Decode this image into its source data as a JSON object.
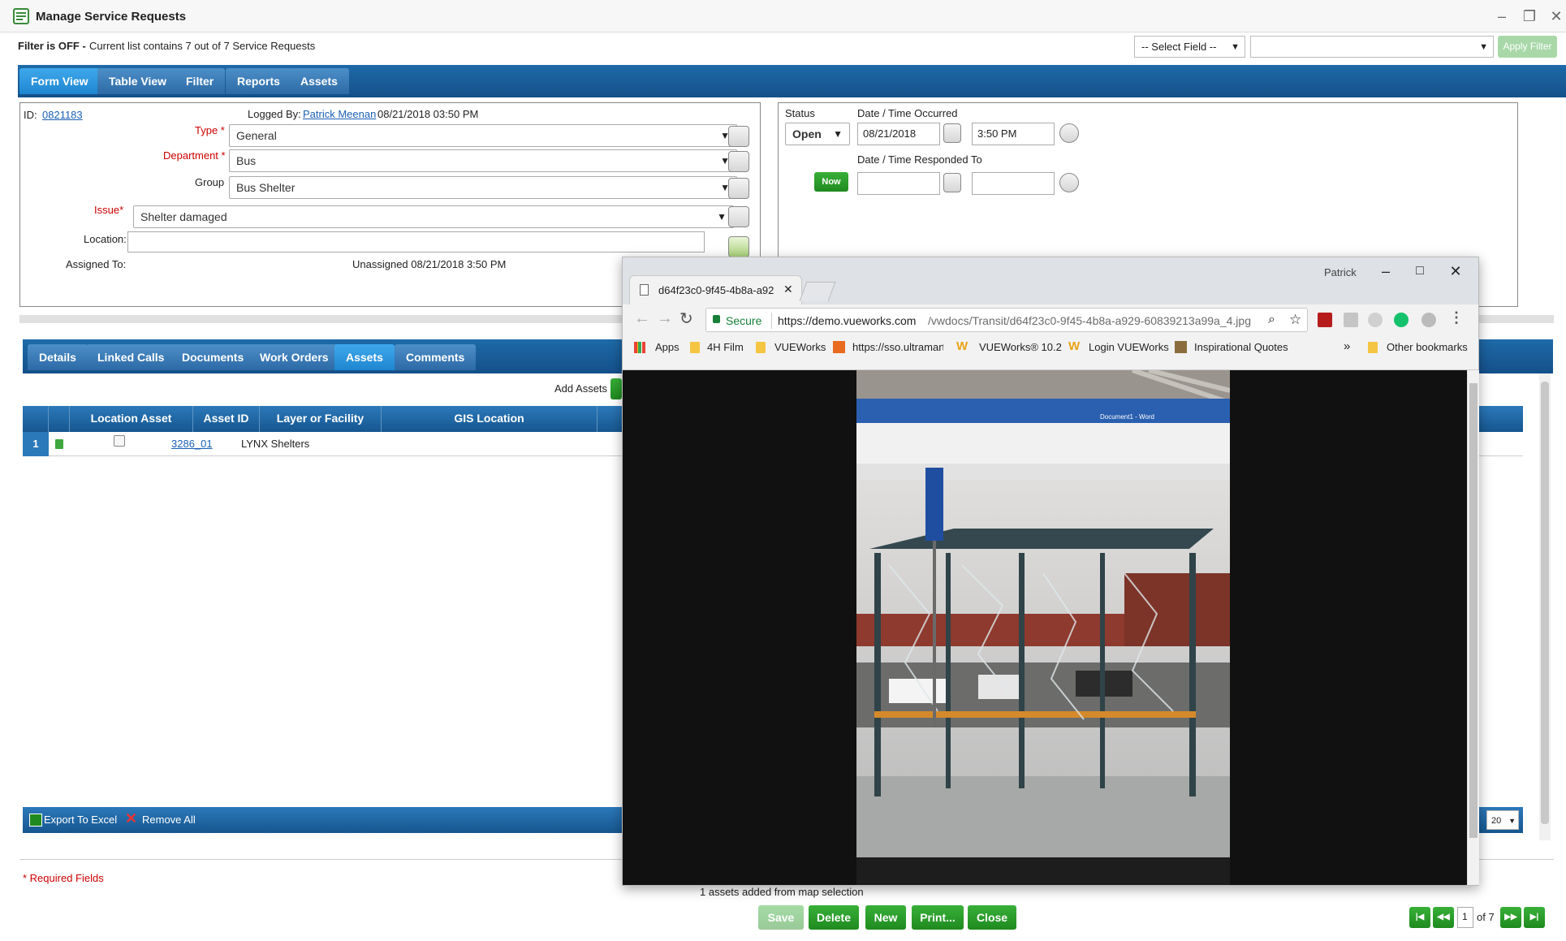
{
  "window": {
    "title": "Manage Service Requests",
    "controls": [
      "minimize-icon",
      "restore-icon",
      "close-icon"
    ]
  },
  "filter": {
    "status": "Filter is OFF -",
    "summary": "Current list contains 7 out of 7 Service Requests",
    "select_field": "-- Select Field --",
    "value_field": "",
    "apply_label": "Apply Filter"
  },
  "tabs": [
    {
      "label": "Form View",
      "active": true
    },
    {
      "label": "Table View",
      "active": false
    },
    {
      "label": "Filter",
      "active": false
    },
    {
      "label": "Reports",
      "active": false
    },
    {
      "label": "Assets",
      "active": false
    }
  ],
  "form": {
    "id_label": "ID:",
    "id_value": "0821183",
    "logged_by_label": "Logged By:",
    "logged_by_name": "Patrick Meenan",
    "logged_by_time": "08/21/2018 03:50 PM",
    "type_label": "Type *",
    "type_value": "General",
    "dept_label": "Department *",
    "dept_value": "Bus",
    "group_label": "Group",
    "group_value": "Bus Shelter",
    "issue_label": "Issue*",
    "issue_value": "Shelter damaged",
    "location_label": "Location:",
    "location_value": "",
    "assigned_label": "Assigned To:",
    "assigned_value": "Unassigned 08/21/2018 3:50 PM"
  },
  "status": {
    "status_label": "Status",
    "status_value": "Open",
    "occurred_label": "Date / Time Occurred",
    "occurred_date": "08/21/2018",
    "occurred_time": "3:50 PM",
    "responded_label": "Date / Time Responded To",
    "now_label": "Now",
    "responded_date": "",
    "responded_time": ""
  },
  "subtabs": [
    {
      "label": "Details",
      "active": false
    },
    {
      "label": "Linked Calls",
      "active": false
    },
    {
      "label": "Documents",
      "active": false
    },
    {
      "label": "Work Orders",
      "active": false
    },
    {
      "label": "Assets",
      "active": true
    },
    {
      "label": "Comments",
      "active": false
    }
  ],
  "assets": {
    "add_label": "Add Assets",
    "columns": [
      "Location Asset",
      "Asset ID",
      "Layer or Facility",
      "GIS Location"
    ],
    "rows": [
      {
        "num": "1",
        "asset_id": "3286_01",
        "layer": "LYNX Shelters",
        "gis": ""
      }
    ],
    "export_label": "Export To Excel",
    "remove_label": "Remove All",
    "page_size": "20"
  },
  "footer": {
    "required_note": "* Required Fields",
    "message": "1 assets added from map selection",
    "buttons": [
      "Save",
      "Delete",
      "New",
      "Print...",
      "Close"
    ],
    "page_current": "1",
    "page_total": "of 7"
  },
  "browser": {
    "profile": "Patrick",
    "tab_title": "d64f23c0-9f45-4b8a-a92",
    "secure_label": "Secure",
    "url_host": "https://demo.vueworks.com",
    "url_path": "/vwdocs/Transit/d64f23c0-9f45-4b8a-a929-60839213a99a_4.jpg",
    "bookmarks": [
      "Apps",
      "4H Film",
      "VUEWorks",
      "https://sso.ultramart",
      "VUEWorks® 10.2",
      "Login VUEWorks",
      "Inspirational Quotes"
    ],
    "more": "»",
    "other_bookmarks": "Other bookmarks"
  },
  "photo": {
    "subject": "broken-glass-bus-shelter-photo",
    "screen_text": "Document1 - Word"
  },
  "colors": {
    "tab_blue": "#1e6aa8",
    "tab_active": "#3fa8ec",
    "green": "#2e9e2e",
    "required_red": "#cc0000",
    "link_blue": "#1a5fb4"
  }
}
